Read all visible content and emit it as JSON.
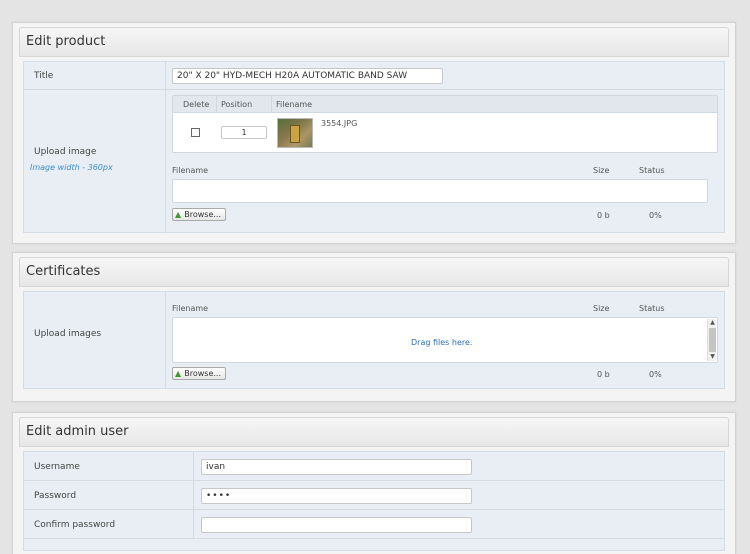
{
  "product": {
    "title": "Edit product",
    "title_label": "Title",
    "title_value": "20\" X 20\" HYD-MECH H20A AUTOMATIC BAND SAW",
    "upload_label": "Upload image",
    "upload_hint": "Image width - 360px",
    "table_headers": {
      "delete": "Delete",
      "position": "Position",
      "filename": "Filename"
    },
    "image_row": {
      "position": "1",
      "filename": "3554.JPG"
    },
    "upload_headers": {
      "filename": "Filename",
      "size": "Size",
      "status": "Status"
    },
    "browse_label": "Browse...",
    "size_value": "0 b",
    "status_value": "0%"
  },
  "certificates": {
    "title": "Certificates",
    "upload_label": "Upload images",
    "upload_headers": {
      "filename": "Filename",
      "size": "Size",
      "status": "Status"
    },
    "drop_text": "Drag files here.",
    "browse_label": "Browse...",
    "size_value": "0 b",
    "status_value": "0%"
  },
  "admin": {
    "title": "Edit admin user",
    "username_label": "Username",
    "username_value": "ivan",
    "password_label": "Password",
    "password_value": "••••",
    "confirm_label": "Confirm password",
    "confirm_value": ""
  },
  "colors": {
    "hint": "#3a8fd0",
    "drop_text": "#2a6fb0",
    "browse_arrow": "#3d9a2d"
  }
}
